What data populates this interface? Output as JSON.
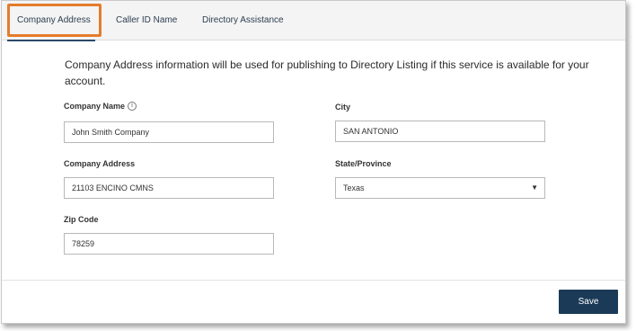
{
  "tabs": [
    {
      "label": "Company Address",
      "active": true
    },
    {
      "label": "Caller ID Name",
      "active": false
    },
    {
      "label": "Directory Assistance",
      "active": false
    }
  ],
  "intro": "Company Address information will be used for publishing to Directory Listing if this service is available for your account.",
  "form": {
    "company_name": {
      "label": "Company Name",
      "value": "John Smith Company",
      "icon": "info-icon"
    },
    "company_address": {
      "label": "Company Address",
      "value": "21103 ENCINO CMNS"
    },
    "zip_code": {
      "label": "Zip Code",
      "value": "78259"
    },
    "city": {
      "label": "City",
      "value": "SAN ANTONIO"
    },
    "state": {
      "label": "State/Province",
      "value": "Texas",
      "icon": "chevron-down-icon"
    }
  },
  "footer": {
    "save_label": "Save"
  },
  "colors": {
    "accent": "#1b3a57",
    "highlight": "#e47c2b"
  }
}
